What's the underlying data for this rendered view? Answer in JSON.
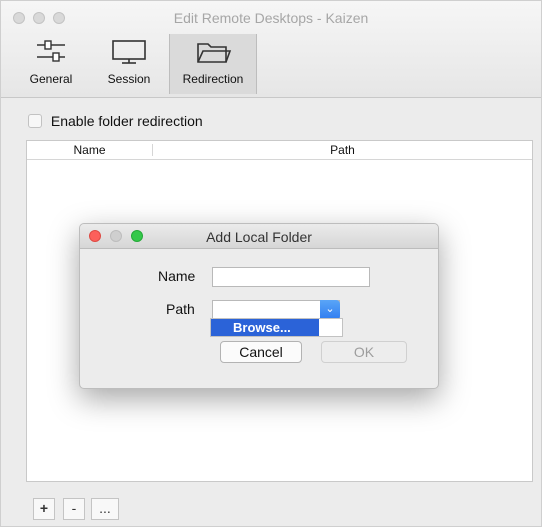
{
  "window": {
    "title": "Edit Remote Desktops - Kaizen"
  },
  "toolbar": {
    "items": [
      {
        "label": "General",
        "icon": "sliders-icon"
      },
      {
        "label": "Session",
        "icon": "monitor-icon"
      },
      {
        "label": "Redirection",
        "icon": "folder-icon",
        "active": true
      }
    ]
  },
  "redirection": {
    "enable_label": "Enable folder redirection",
    "enabled": false,
    "columns": [
      "Name",
      "Path"
    ],
    "rows": []
  },
  "bottom_buttons": [
    "+",
    "-",
    "..."
  ],
  "dialog": {
    "title": "Add Local Folder",
    "name_label": "Name",
    "name_value": "",
    "path_label": "Path",
    "path_value": "",
    "dropdown_option": "Browse...",
    "cancel_label": "Cancel",
    "ok_label": "OK"
  },
  "colors": {
    "accent": "#2b63d8",
    "close": "#fc605b",
    "minimize": "#fdbc40",
    "zoom": "#34c84a"
  }
}
